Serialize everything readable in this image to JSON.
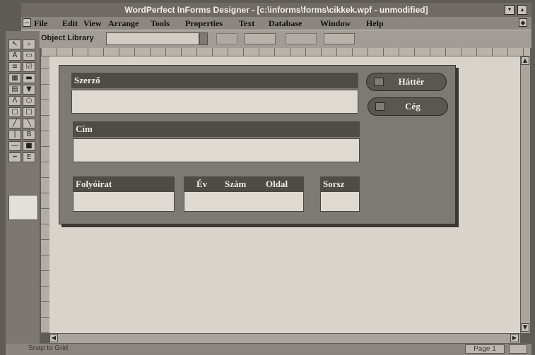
{
  "window": {
    "title": "WordPerfect InForms Designer - [c:\\informs\\forms\\cikkek.wpf - unmodified]"
  },
  "menu": [
    "File",
    "Edit",
    "View",
    "Arrange",
    "Tools",
    "Properties",
    "Text",
    "Database",
    "Window",
    "Help"
  ],
  "toolbar": {
    "object_library_label": "Object Library",
    "object_library_value": ""
  },
  "form": {
    "fields": {
      "szerzo": "Szerző",
      "cim": "Cím",
      "folyoirat": "Folyóirat",
      "ev": "Év",
      "szam": "Szám",
      "oldal": "Oldal",
      "sorsz": "Sorsz"
    },
    "buttons": {
      "hatter": "Háttér",
      "ceg": "Cég"
    }
  },
  "status": {
    "text": "Snap to Grid",
    "page": "Page 1"
  },
  "icons": [
    "arrow-icon",
    "zoom-icon",
    "text-tool-icon",
    "field-tool-icon",
    "line-tool-icon",
    "rectangle-tool-icon",
    "ellipse-tool-icon",
    "checkbox-tool-icon"
  ]
}
